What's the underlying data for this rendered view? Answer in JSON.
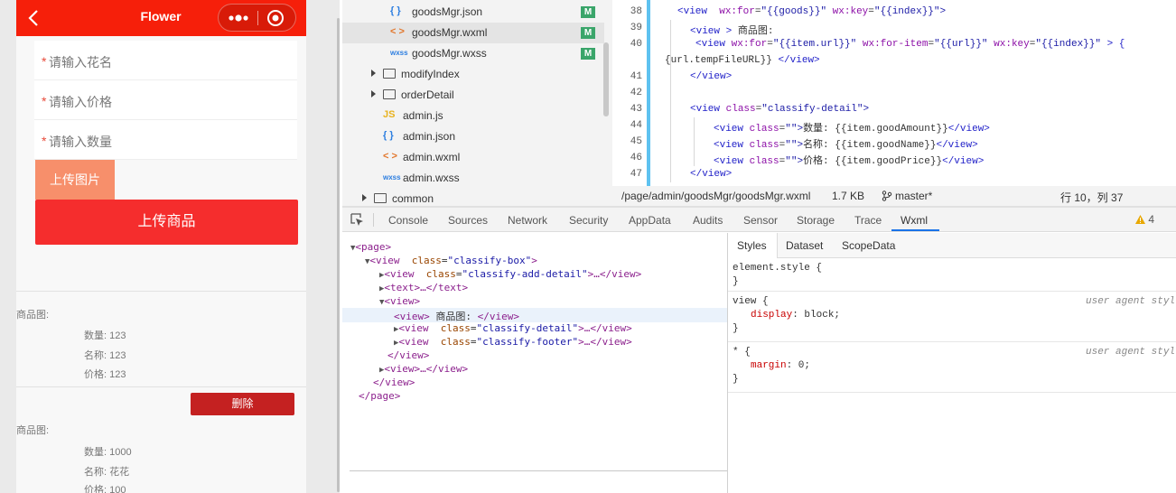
{
  "simulator": {
    "nav_title": "Flower",
    "form": {
      "required_mark": "*",
      "name_placeholder": "请输入花名",
      "price_placeholder": "请输入价格",
      "quantity_placeholder": "请输入数量",
      "upload_image_label": "上传图片",
      "upload_goods_label": "上传商品"
    },
    "products": [
      {
        "image_label": "商品图:",
        "quantity": "数量: 123",
        "name": "名称: 123",
        "price": "价格: 123"
      },
      {
        "image_label": "商品图:",
        "quantity": "数量: 1000",
        "name": "名称: 花花",
        "price": "价格: 100"
      }
    ],
    "delete_label": "删除"
  },
  "file_tree": {
    "items": [
      {
        "label": "goodsMgr.json",
        "icon": "{ }",
        "badge": "M"
      },
      {
        "label": "goodsMgr.wxml",
        "icon": "< >",
        "badge": "M"
      },
      {
        "label": "goodsMgr.wxss",
        "icon": "wxss",
        "badge": "M"
      },
      {
        "label": "modifyIndex"
      },
      {
        "label": "orderDetail"
      },
      {
        "label": "admin.js",
        "icon": "JS"
      },
      {
        "label": "admin.json",
        "icon": "{ }"
      },
      {
        "label": "admin.wxml",
        "icon": "< >"
      },
      {
        "label": "admin.wxss",
        "icon": "wxss"
      },
      {
        "label": "common"
      }
    ]
  },
  "editor": {
    "line_numbers": [
      "38",
      "39",
      "40",
      "41",
      "42",
      "43",
      "44",
      "45",
      "46",
      "47"
    ],
    "code": {
      "l38_tag": "<view",
      "l38_attr1": "wx:for",
      "l38_val1": "\"{{goods}}\"",
      "l38_attr2": "wx:key",
      "l38_val2": "\"{{index}}\">",
      "l39_tag": "<view",
      "l39_close": ">",
      "l39_text": "商品图:",
      "l40_tag": "<view",
      "l40_attr1": "wx:for",
      "l40_val1": "\"{{item.url}}\"",
      "l40_attr2": "wx:for-item",
      "l40_val2": "\"{{url}}\"",
      "l40_attr3": "wx:key",
      "l40_val3": "\"{{index}}\"",
      "l40_end": "> {",
      "l40_wrap": "{url.tempFileURL}}",
      "l40_wrap_close": "</view>",
      "l41": "</view>",
      "l43_tag": "<view",
      "l43_attr": "class",
      "l43_val": "\"classify-detail\">",
      "l44_tag": "<view",
      "l44_attr": "class",
      "l44_val": "\"\">",
      "l44_text": "数量: {{item.goodAmount}}",
      "l44_close": "</view>",
      "l45_tag": "<view",
      "l45_attr": "class",
      "l45_val": "\"\">",
      "l45_text": "名称: {{item.goodName}}",
      "l45_close": "</view>",
      "l46_tag": "<view",
      "l46_attr": "class",
      "l46_val": "\"\">",
      "l46_text": "价格: {{item.goodPrice}}",
      "l46_close": "</view>",
      "l47": "</view>"
    }
  },
  "status_bar": {
    "path": "/page/admin/goodsMgr/goodsMgr.wxml",
    "size": "1.7 KB",
    "branch": "master*",
    "cursor": "行 10，列 37"
  },
  "devtools": {
    "tabs": [
      "Console",
      "Sources",
      "Network",
      "Security",
      "AppData",
      "Audits",
      "Sensor",
      "Storage",
      "Trace",
      "Wxml"
    ],
    "active_tab": "Wxml",
    "warning_count": "4"
  },
  "wxml_tree": {
    "page_open": "<page>",
    "box_tag": "<view",
    "box_attr": "class",
    "box_val": "\"classify-box\"",
    "box_end": ">",
    "add_tag": "<view",
    "add_attr": "class",
    "add_val": "\"classify-add-detail\"",
    "add_end": ">…</view>",
    "text_node": "<text>…</text>",
    "view_open": "<view>",
    "sel_tag": "<view>",
    "sel_text": "商品图: ",
    "sel_close": "</view>",
    "detail_tag": "<view",
    "detail_attr": "class",
    "detail_val": "\"classify-detail\"",
    "detail_end": ">…</view>",
    "footer_tag": "<view",
    "footer_attr": "class",
    "footer_val": "\"classify-footer\"",
    "footer_end": ">…</view>",
    "view_close": "</view>",
    "view_collapsed": "<view>…</view>",
    "box_close": "</view>",
    "page_close": "</page>"
  },
  "styles": {
    "tabs": [
      "Styles",
      "Dataset",
      "ScopeData"
    ],
    "element_style": "element.style {",
    "close_brace": "}",
    "view_selector": "view {",
    "user_agent": "user agent styl",
    "display_prop": "display",
    "display_val": ": block;",
    "star_selector": "* {",
    "margin_prop": "margin",
    "margin_val": ": 0;"
  },
  "colors": {
    "nav_red": "#f61f0a",
    "upload_button": "#f52d2d",
    "upload_image_button": "#f78f6b",
    "delete_button": "#c42121",
    "git_modified_badge": "#3aa56a",
    "active_tab_underline": "#1a73e8"
  }
}
